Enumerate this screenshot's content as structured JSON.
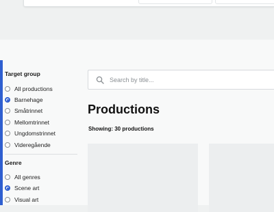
{
  "filters": {
    "target_group": {
      "heading": "Target group",
      "options": [
        {
          "label": "All productions",
          "checked": false
        },
        {
          "label": "Barnehage",
          "checked": true
        },
        {
          "label": "Småtrinnet",
          "checked": false
        },
        {
          "label": "Mellomtrinnet",
          "checked": false
        },
        {
          "label": "Ungdomstrinnet",
          "checked": false
        },
        {
          "label": "Videregående",
          "checked": false
        }
      ]
    },
    "genre": {
      "heading": "Genre",
      "options": [
        {
          "label": "All genres",
          "checked": false
        },
        {
          "label": "Scene art",
          "checked": true
        },
        {
          "label": "Visual art",
          "checked": false
        }
      ]
    }
  },
  "search": {
    "placeholder": "Search by title..."
  },
  "main": {
    "title": "Productions",
    "showing": "Showing: 30 productions"
  },
  "colors": {
    "accent": "#2f5fd0",
    "background": "#eff1f1"
  }
}
